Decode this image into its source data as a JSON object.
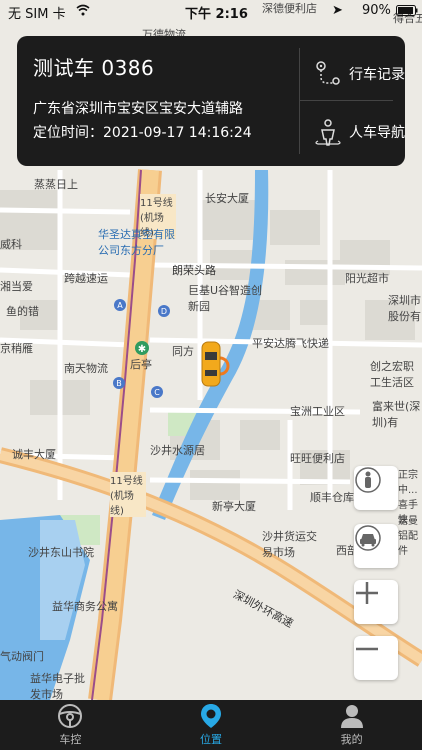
{
  "status_bar": {
    "carrier": "无 SIM 卡",
    "time": "下午 2:16",
    "battery": "90%"
  },
  "vehicle_card": {
    "vehicle_name": "测试车 0386",
    "address": "广东省深圳市宝安区宝安大道辅路",
    "location_time_label": "定位时间：",
    "location_time": "2021-09-17 14:16:24",
    "actions": [
      {
        "label": "行车记录",
        "icon": "route-icon"
      },
      {
        "label": "人车导航",
        "icon": "person-navigation-icon"
      }
    ]
  },
  "map": {
    "labels": [
      {
        "text": "万德物流"
      },
      {
        "text": "深德便利店"
      },
      {
        "text": "得合五"
      },
      {
        "text": "蒸蒸日上"
      },
      {
        "text": "11号线(机场线)"
      },
      {
        "text": "长安大厦"
      },
      {
        "text": "华圣达真空有限公司东方分厂"
      },
      {
        "text": "威科"
      },
      {
        "text": "朗荣头路"
      },
      {
        "text": "跨越速运"
      },
      {
        "text": "阳光超市"
      },
      {
        "text": "湘当爱"
      },
      {
        "text": "巨基U谷智造创新园"
      },
      {
        "text": "深圳市股份有"
      },
      {
        "text": "鱼的错"
      },
      {
        "text": "京稍雁"
      },
      {
        "text": "同方"
      },
      {
        "text": "平安达腾飞快递"
      },
      {
        "text": "后亭"
      },
      {
        "text": "南天物流"
      },
      {
        "text": "创之宏职工生活区"
      },
      {
        "text": "宝洲工业区"
      },
      {
        "text": "富来世(深圳)有"
      },
      {
        "text": "沙井水源居"
      },
      {
        "text": "诚丰大厦"
      },
      {
        "text": "旺旺便利店"
      },
      {
        "text": "11号线(机场线)"
      },
      {
        "text": "正宗中...喜手快"
      },
      {
        "text": "顺丰仓库"
      },
      {
        "text": "新亭大厦"
      },
      {
        "text": "嘉曼铝配件"
      },
      {
        "text": "沙井东山书院"
      },
      {
        "text": "沙井货运交易市场"
      },
      {
        "text": "西部"
      },
      {
        "text": "深圳外环高速"
      },
      {
        "text": "益华商务公寓"
      },
      {
        "text": "气动阀门"
      },
      {
        "text": "益华电子批发市场"
      }
    ],
    "metro_markers": [
      "A",
      "B",
      "C",
      "D"
    ],
    "controls": [
      {
        "name": "street-view-button",
        "icon": "person-icon"
      },
      {
        "name": "vehicle-view-button",
        "icon": "car-icon"
      },
      {
        "name": "zoom-in-button",
        "icon": "plus-icon"
      },
      {
        "name": "zoom-out-button",
        "icon": "minus-icon"
      }
    ],
    "colors": {
      "water": "#77b6e8",
      "road": "#f6c98b",
      "metro_line": "#9b4d8a",
      "car": "#f2a91c"
    }
  },
  "tabbar": {
    "tabs": [
      {
        "label": "车控",
        "icon": "steering-wheel-icon",
        "active": false
      },
      {
        "label": "位置",
        "icon": "location-pin-icon",
        "active": true
      },
      {
        "label": "我的",
        "icon": "profile-icon",
        "active": false
      }
    ]
  }
}
